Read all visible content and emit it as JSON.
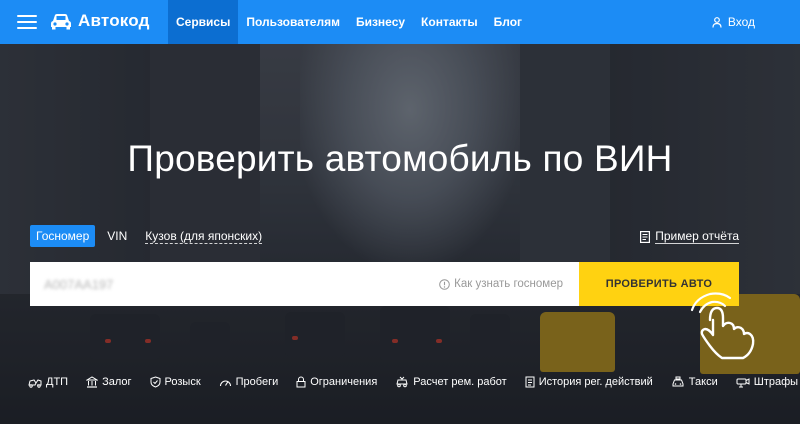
{
  "header": {
    "logo_text": "Автокод",
    "nav": [
      {
        "label": "Сервисы",
        "active": true
      },
      {
        "label": "Пользователям",
        "active": false
      },
      {
        "label": "Бизнесу",
        "active": false
      },
      {
        "label": "Контакты",
        "active": false
      },
      {
        "label": "Блог",
        "active": false
      }
    ],
    "login_label": "Вход"
  },
  "hero": {
    "title": "Проверить автомобиль по ВИН",
    "tabs": [
      {
        "label": "Госномер",
        "active": true
      },
      {
        "label": "VIN",
        "active": false
      },
      {
        "label": "Кузов (для японских)",
        "active": false
      }
    ],
    "sample_report": "Пример отчёта"
  },
  "search": {
    "placeholder": "А007АА197",
    "help_text": "Как узнать госномер",
    "button_label": "ПРОВЕРИТЬ АВТО"
  },
  "services": [
    {
      "label": "ДТП",
      "icon": "crash-icon"
    },
    {
      "label": "Залог",
      "icon": "bank-icon"
    },
    {
      "label": "Розыск",
      "icon": "shield-icon"
    },
    {
      "label": "Пробеги",
      "icon": "speedometer-icon"
    },
    {
      "label": "Ограничения",
      "icon": "lock-icon"
    },
    {
      "label": "Расчет рем. работ",
      "icon": "repair-icon"
    },
    {
      "label": "История рег. действий",
      "icon": "document-icon"
    },
    {
      "label": "Такси",
      "icon": "taxi-icon"
    },
    {
      "label": "Штрафы",
      "icon": "camera-icon"
    }
  ],
  "colors": {
    "header_bg": "#1c8cf5",
    "nav_active_bg": "#0c6ed1",
    "button_bg": "#ffd211"
  }
}
